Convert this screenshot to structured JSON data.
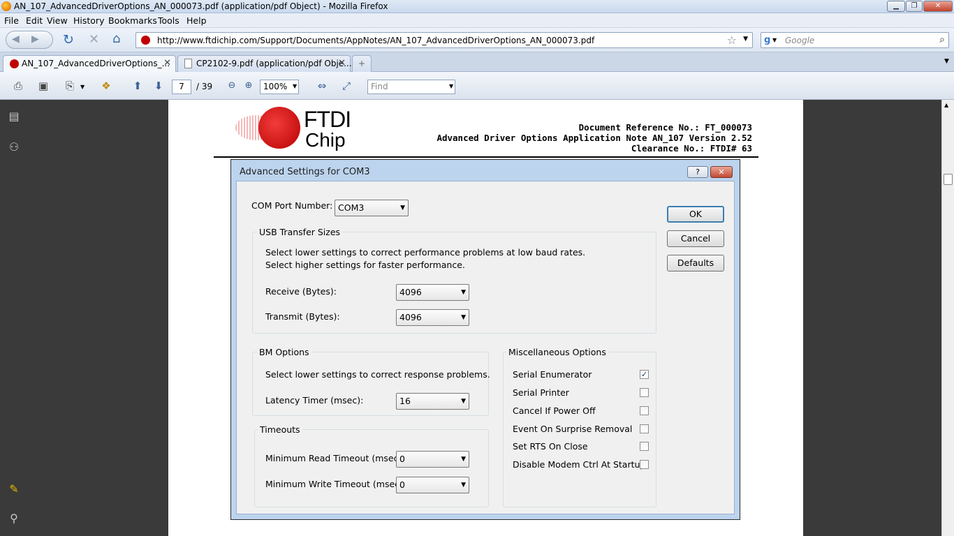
{
  "window": {
    "title": "AN_107_AdvancedDriverOptions_AN_000073.pdf (application/pdf Object) - Mozilla Firefox"
  },
  "menu": [
    "File",
    "Edit",
    "View",
    "History",
    "Bookmarks",
    "Tools",
    "Help"
  ],
  "nav": {
    "url": "http://www.ftdichip.com/Support/Documents/AppNotes/AN_107_AdvancedDriverOptions_AN_000073.pdf",
    "search_placeholder": "Google"
  },
  "tabs": [
    {
      "label": "AN_107_AdvancedDriverOptions_..."
    },
    {
      "label": "CP2102-9.pdf (application/pdf Obje..."
    }
  ],
  "pdf_toolbar": {
    "page": "7",
    "page_total": "/ 39",
    "zoom": "100%",
    "find_placeholder": "Find"
  },
  "doc_header": {
    "logo_line1": "FTDI",
    "logo_line2": "Chip",
    "ref": "Document Reference No.: FT_000073",
    "title": "Advanced Driver Options  Application Note AN_107 Version 2.52",
    "clearance": "Clearance No.: FTDI# 63"
  },
  "dialog": {
    "title": "Advanced Settings for COM3",
    "help_label": "?",
    "close_label": "✕",
    "com_port_label": "COM Port Number:",
    "com_port_value": "COM3",
    "usb": {
      "legend": "USB Transfer Sizes",
      "note1": "Select lower settings to correct performance problems at low baud rates.",
      "note2": "Select higher settings for faster performance.",
      "receive_label": "Receive (Bytes):",
      "receive_value": "4096",
      "transmit_label": "Transmit (Bytes):",
      "transmit_value": "4096"
    },
    "bm": {
      "legend": "BM Options",
      "note": "Select lower settings to correct response problems.",
      "latency_label": "Latency Timer (msec):",
      "latency_value": "16"
    },
    "timeouts": {
      "legend": "Timeouts",
      "read_label": "Minimum Read Timeout (msec):",
      "read_value": "0",
      "write_label": "Minimum Write Timeout (msec):",
      "write_value": "0"
    },
    "misc": {
      "legend": "Miscellaneous Options",
      "options": [
        {
          "label": "Serial Enumerator",
          "checked": true
        },
        {
          "label": "Serial Printer",
          "checked": false
        },
        {
          "label": "Cancel If Power Off",
          "checked": false
        },
        {
          "label": "Event On Surprise Removal",
          "checked": false
        },
        {
          "label": "Set RTS On Close",
          "checked": false
        },
        {
          "label": "Disable Modem Ctrl At Startup",
          "checked": false
        }
      ]
    },
    "buttons": {
      "ok": "OK",
      "cancel": "Cancel",
      "defaults": "Defaults"
    }
  }
}
